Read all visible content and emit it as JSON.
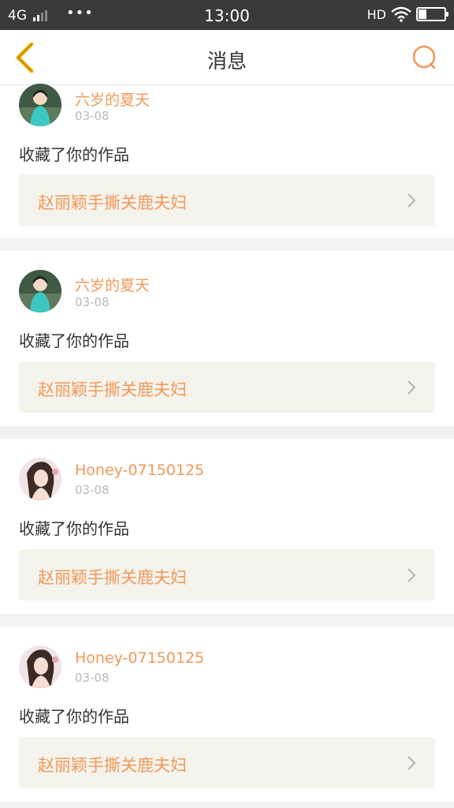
{
  "status": {
    "network": "4G",
    "dots": "•••",
    "time": "13:00",
    "hd": "HD"
  },
  "header": {
    "title": "消息",
    "back_icon": "chevron-left-icon",
    "search_icon": "search-icon",
    "accent": "#f5b400"
  },
  "messages": [
    {
      "user": "六岁的夏天",
      "date": "03-08",
      "action": "收藏了你的作品",
      "work": "赵丽颖手撕关鹿夫妇"
    },
    {
      "user": "六岁的夏天",
      "date": "03-08",
      "action": "收藏了你的作品",
      "work": "赵丽颖手撕关鹿夫妇"
    },
    {
      "user": "Honey-07150125",
      "date": "03-08",
      "action": "收藏了你的作品",
      "work": "赵丽颖手撕关鹿夫妇"
    },
    {
      "user": "Honey-07150125",
      "date": "03-08",
      "action": "收藏了你的作品",
      "work": "赵丽颖手撕关鹿夫妇"
    }
  ],
  "colors": {
    "username": "#f0995a",
    "work_bg": "#f4f3ec",
    "separator": "#f2f2f2"
  }
}
